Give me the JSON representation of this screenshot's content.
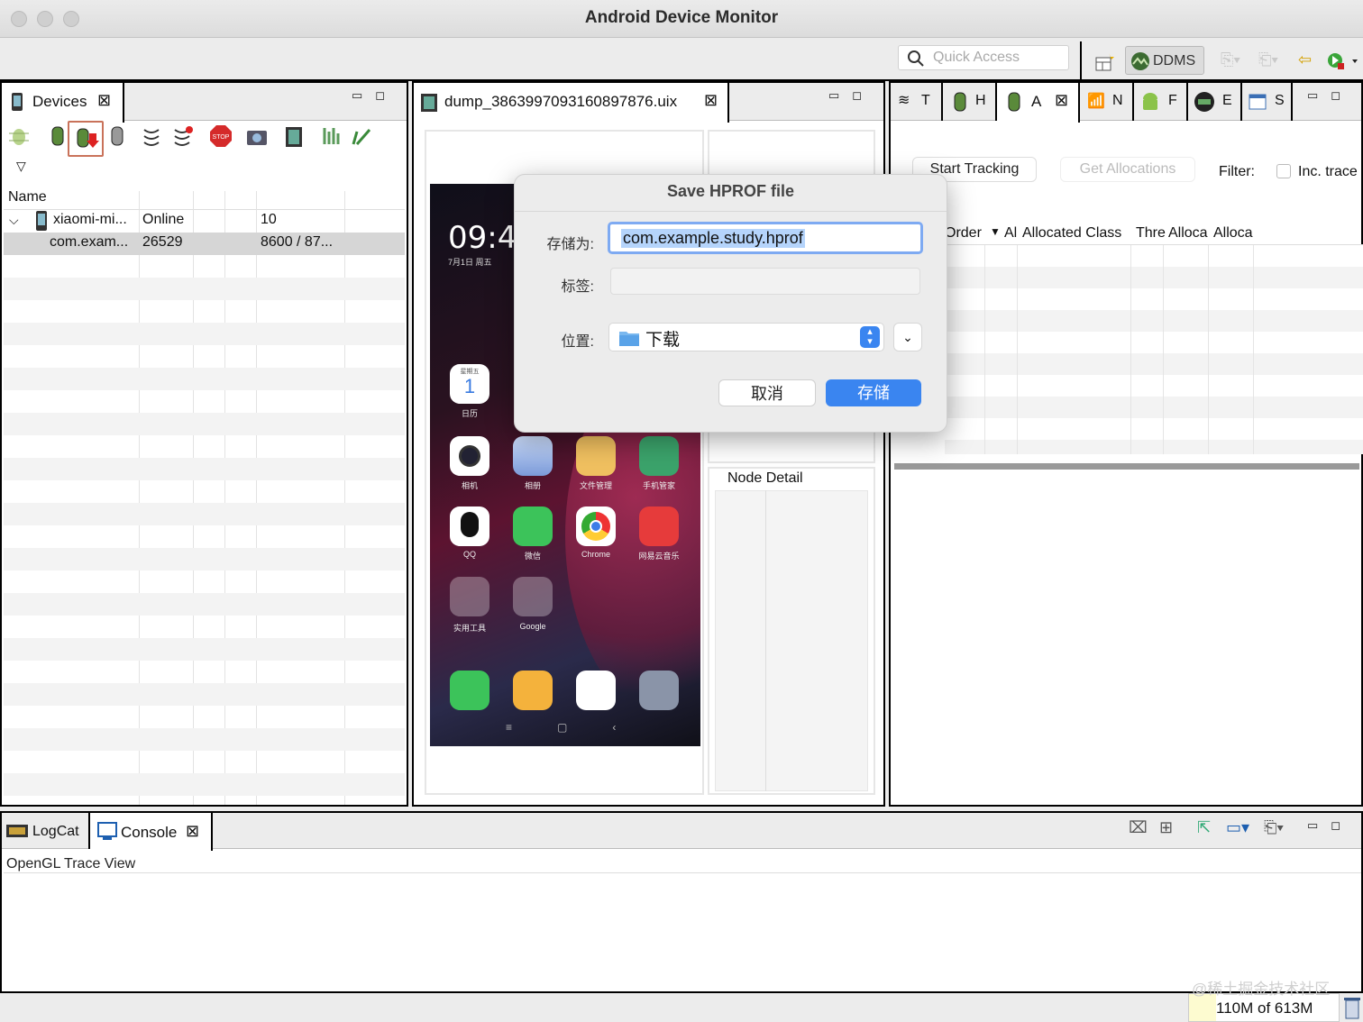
{
  "window": {
    "title": "Android Device Monitor"
  },
  "toolbar": {
    "quick_access_placeholder": "Quick Access",
    "perspective_label": "DDMS"
  },
  "devices_panel": {
    "tab_label": "Devices",
    "column_header": "Name",
    "rows": [
      {
        "name": "xiaomi-mi...",
        "col2": "Online",
        "col3": "",
        "col4": "10"
      },
      {
        "name": "com.exam...",
        "col2": "26529",
        "col3": "",
        "col4": "8600 / 87..."
      }
    ]
  },
  "dump_panel": {
    "tab_label": "dump_3863997093160897876.uix",
    "node_detail_label": "Node Detail",
    "phone": {
      "time": "09:4",
      "date": "7月1日 周五",
      "calendar_weekday": "星期五",
      "calendar_day": "1",
      "apps": [
        "日历",
        "相机",
        "相册",
        "文件管理",
        "手机管家",
        "QQ",
        "微信",
        "Chrome",
        "网易云音乐",
        "实用工具",
        "Google"
      ]
    }
  },
  "right_panel": {
    "tabs": [
      "T",
      "H",
      "A",
      "N",
      "F",
      "E",
      "S"
    ],
    "start_tracking": "Start Tracking",
    "get_allocations": "Get Allocations",
    "filter_label": "Filter:",
    "inc_trace_label": "Inc. trace",
    "columns": [
      "Order",
      "Al",
      "Allocated Class",
      "Thre",
      "Alloca",
      "Alloca"
    ]
  },
  "bottom_panel": {
    "tabs": [
      "LogCat",
      "Console"
    ],
    "line": "OpenGL Trace View"
  },
  "status": {
    "memory": "110M of 613M",
    "watermark": "@稀土掘金技术社区"
  },
  "dialog": {
    "title": "Save HPROF file",
    "save_as_label": "存储为:",
    "save_as_value": "com.example.study.hprof",
    "tags_label": "标签:",
    "location_label": "位置:",
    "location_value": "下载",
    "cancel_label": "取消",
    "save_label": "存储"
  },
  "colors": {
    "accent": "#3a85f0",
    "selection": "#b5d4fb"
  }
}
